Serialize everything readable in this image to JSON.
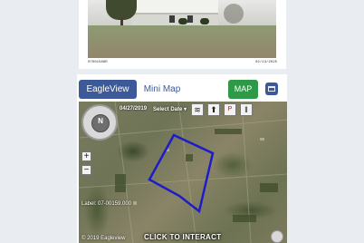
{
  "photo": {
    "left_caption": "07001586R",
    "right_caption": "02/13/2025"
  },
  "map_section": {
    "tabs": [
      {
        "label": "EagleView",
        "active": true
      },
      {
        "label": "Mini Map",
        "active": false
      }
    ],
    "map_button": "MAP",
    "panel_icon": "window-icon"
  },
  "aerial": {
    "date": "04/27/2019",
    "select_date": "Select Date",
    "compass_label": "N",
    "zoom_in": "+",
    "zoom_out": "−",
    "apn": "Label: 07-00159.000",
    "copyright": "© 2019 Eagleview",
    "click_to_interact": "CLICK TO INTERACT",
    "tools": [
      "layers-icon",
      "pin-icon",
      "pdf-icon",
      "split-icon"
    ],
    "colors": {
      "parcel": "#1c1cc8",
      "accent": "#3d5a98",
      "map_button": "#2e9a47"
    }
  }
}
